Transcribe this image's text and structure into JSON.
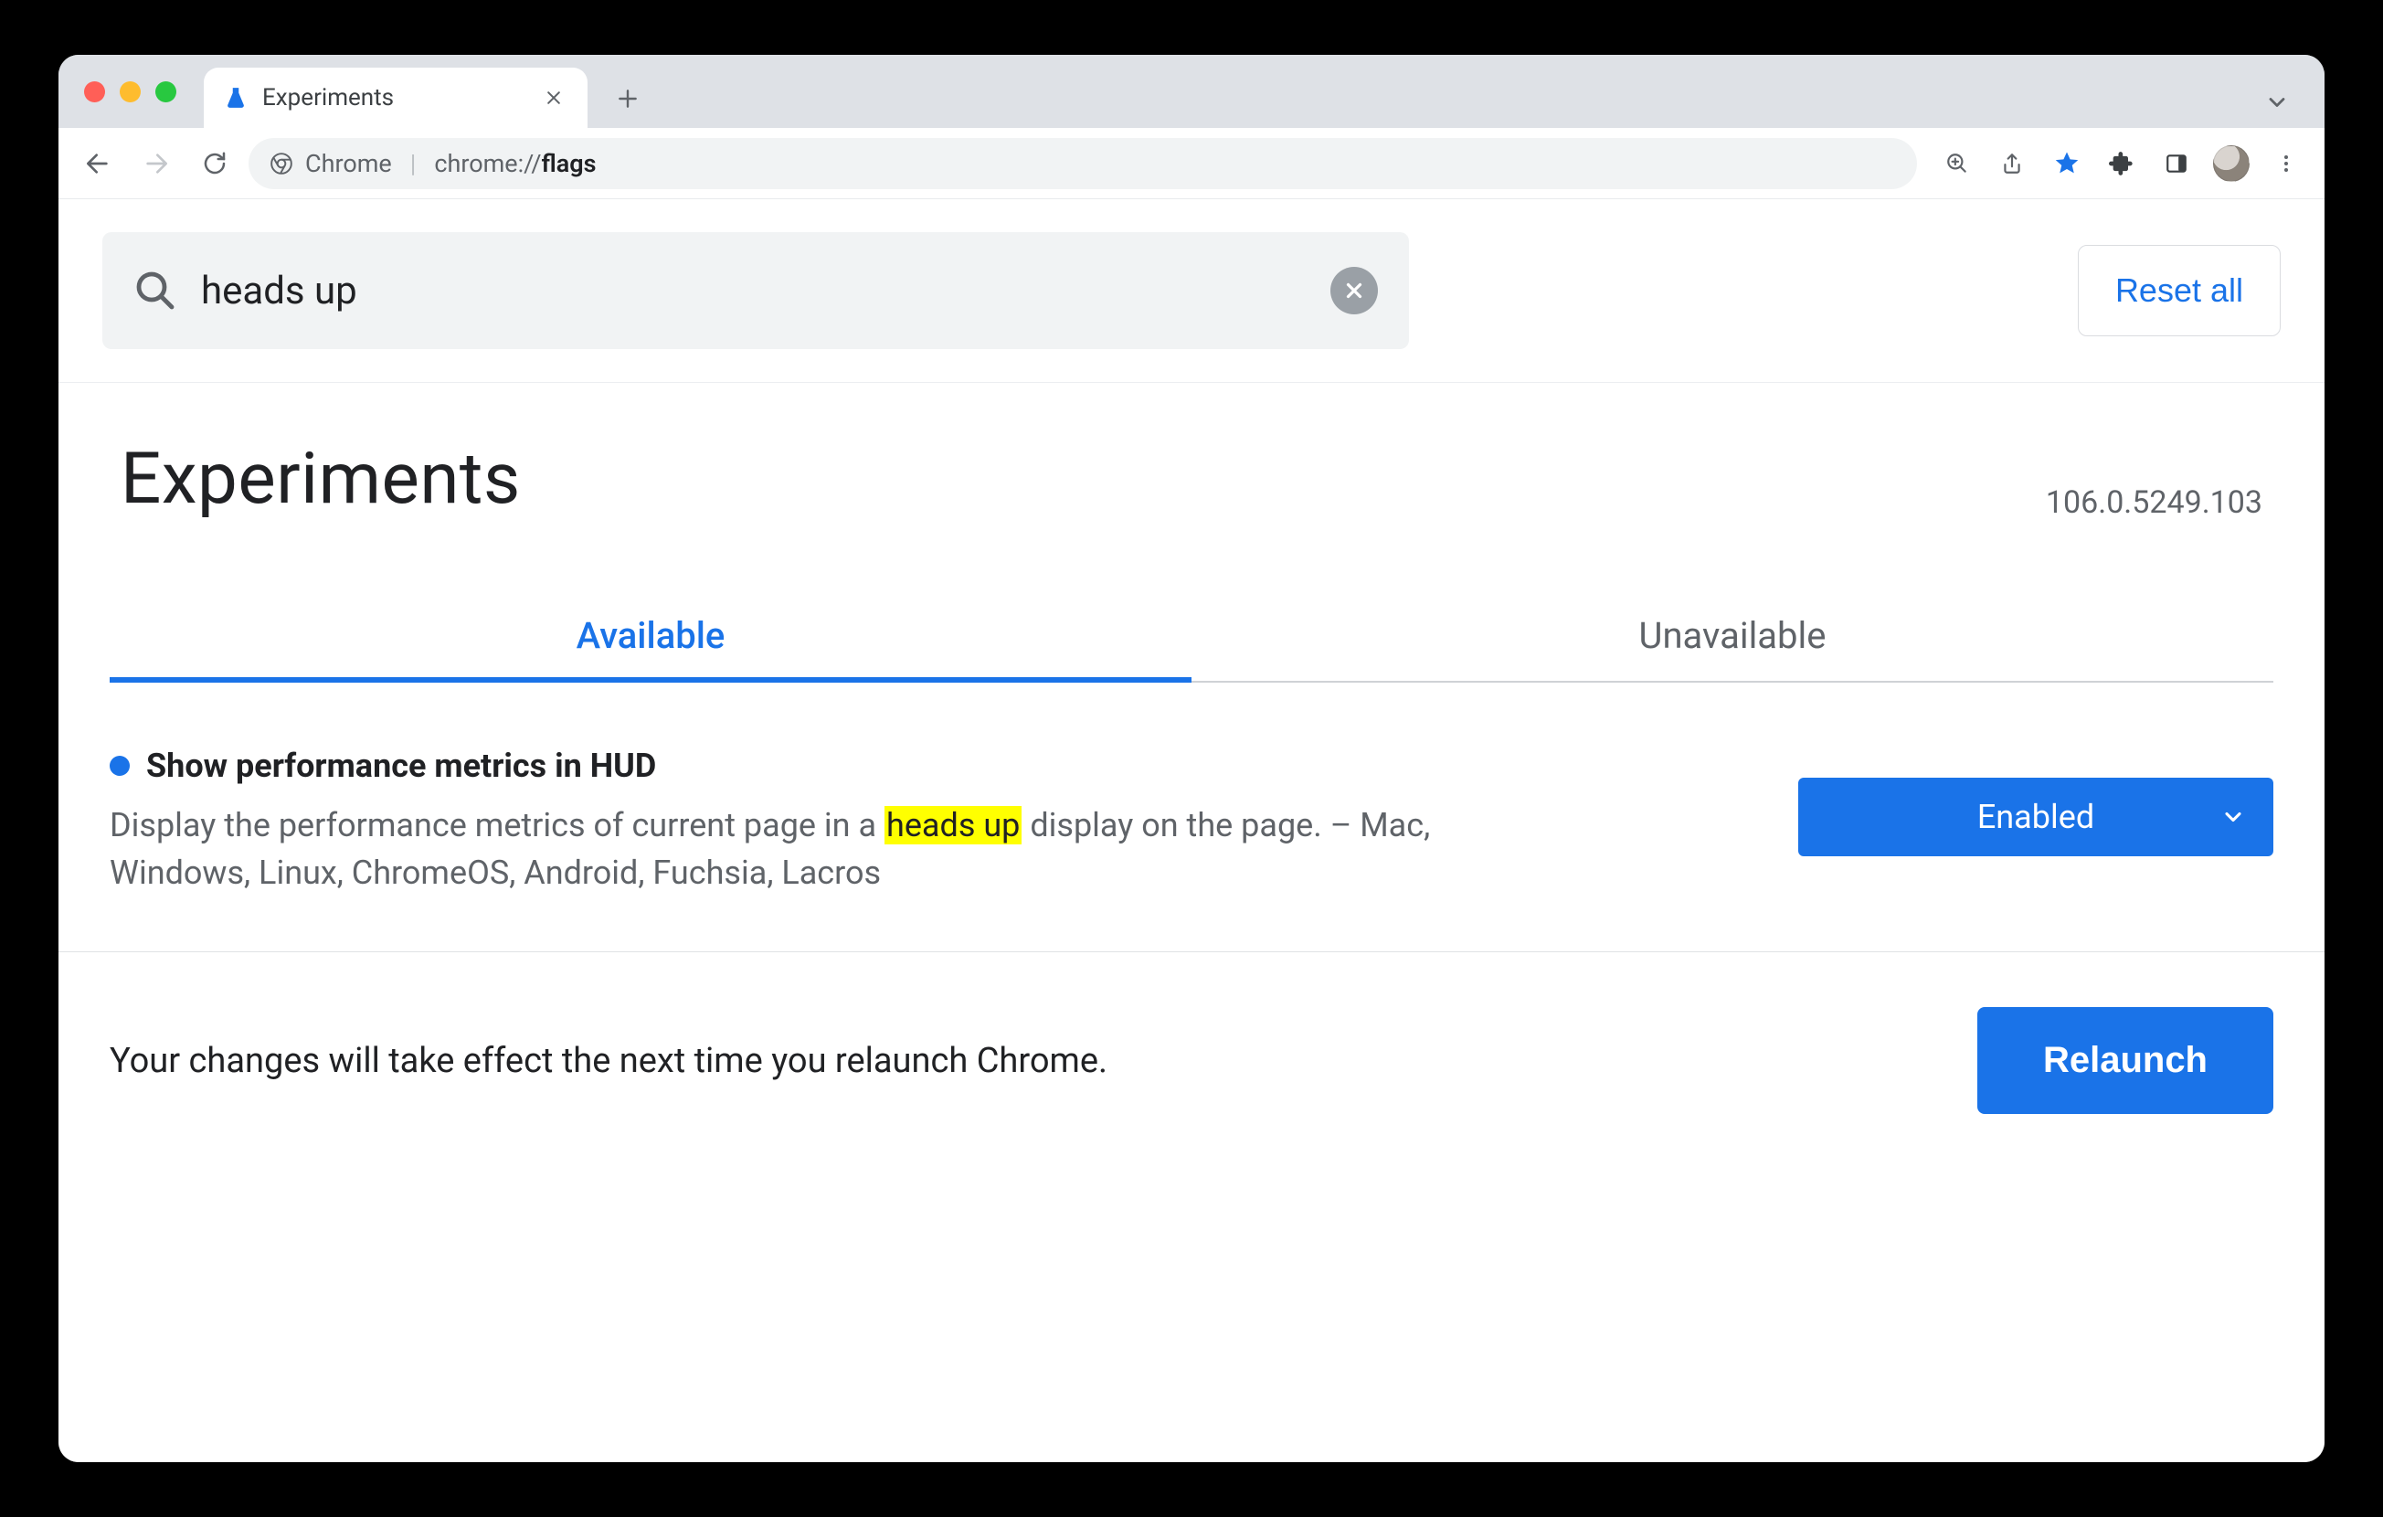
{
  "window": {
    "tab_title": "Experiments"
  },
  "omnibox": {
    "scheme_label": "Chrome",
    "url_prefix": "chrome://",
    "url_path": "flags"
  },
  "search": {
    "value": "heads up",
    "reset_label": "Reset all"
  },
  "page_title": "Experiments",
  "version": "106.0.5249.103",
  "tabs": {
    "available": "Available",
    "unavailable": "Unavailable",
    "active": "available"
  },
  "flag": {
    "title": "Show performance metrics in HUD",
    "desc_pre": "Display the performance metrics of current page in a ",
    "desc_highlight": "heads up",
    "desc_post": " display on the page. – Mac, Windows, Linux, ChromeOS, Android, Fuchsia, Lacros",
    "select_value": "Enabled"
  },
  "footer": {
    "message": "Your changes will take effect the next time you relaunch Chrome.",
    "button": "Relaunch"
  }
}
